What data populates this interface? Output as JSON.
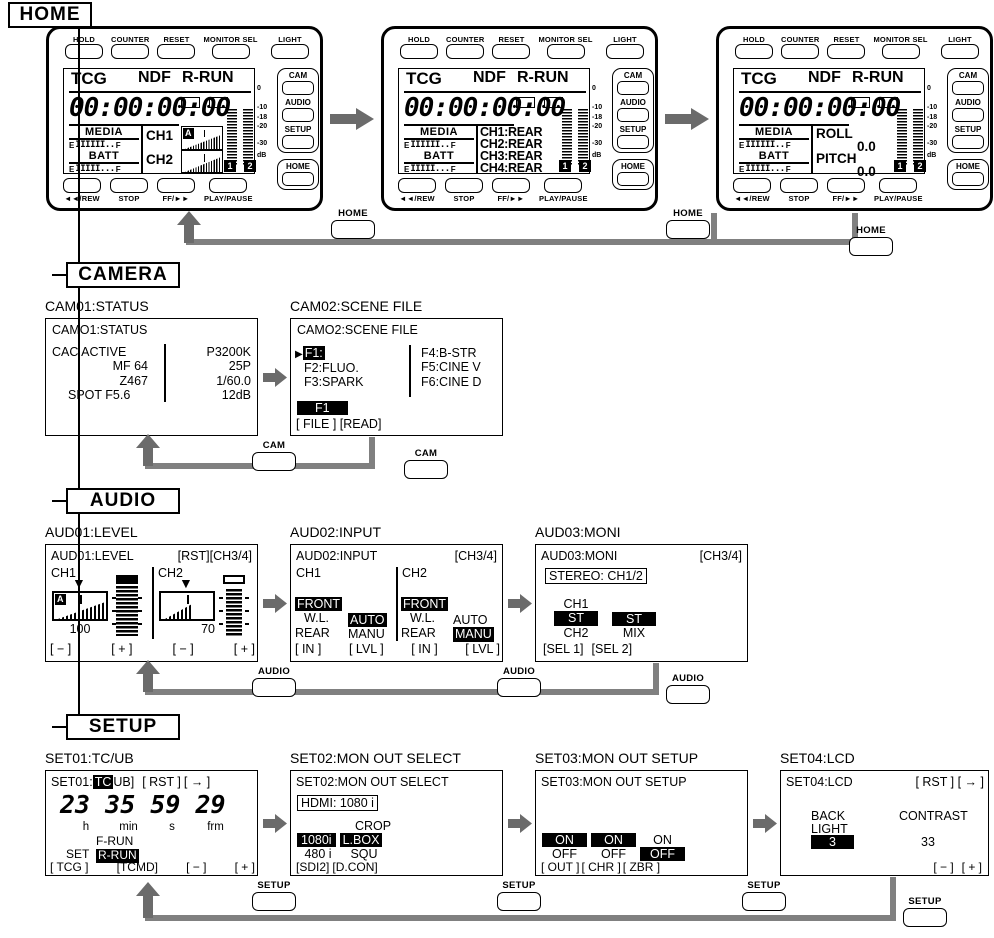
{
  "sections": {
    "home": "HOME",
    "camera": "CAMERA",
    "audio": "AUDIO",
    "setup": "SETUP"
  },
  "device_buttons": {
    "top": [
      "HOLD",
      "COUNTER",
      "RESET",
      "MONITOR SEL"
    ],
    "light": "LIGHT",
    "side": [
      "CAM",
      "AUDIO",
      "SETUP"
    ],
    "home": "HOME",
    "bottom": [
      "◄◄/REW",
      "STOP",
      "FF/►►",
      "PLAY/PAUSE"
    ]
  },
  "lcd_common": {
    "tcg": "TCG",
    "ndf": "NDF",
    "run": "R-RUN",
    "timecode": "00:00:00:00",
    "media_label": "MEDIA",
    "media_ticks": "IIIIII..",
    "batt_label": "BATT",
    "batt_ticks": "IIIII...",
    "e": "E",
    "f": "F",
    "scale": [
      "0",
      "-10",
      "-18",
      "-20",
      "-30",
      "dB"
    ],
    "badge1": "1",
    "badge2": "2"
  },
  "home_screens": [
    {
      "id": "home-1",
      "type": "ch-meter",
      "ch1": "CH1",
      "ch2": "CH2",
      "a_badge": "A"
    },
    {
      "id": "home-2",
      "type": "ch-list",
      "lines": [
        "CH1:REAR",
        "CH2:REAR",
        "CH3:REAR",
        "CH4:REAR"
      ]
    },
    {
      "id": "home-3",
      "type": "roll-pitch",
      "roll_label": "ROLL",
      "roll_value": "0.0",
      "pitch_label": "PITCH",
      "pitch_value": "0.0"
    }
  ],
  "camera": {
    "screens": [
      {
        "caption": "CAM01:STATUS",
        "header": "CAMO1:STATUS",
        "left": [
          "CAC   ACTIVE",
          "MF 64",
          "Z467",
          "SPOT   F5.6"
        ],
        "right": [
          "P3200K",
          "25P",
          "1/60.0",
          "12dB"
        ]
      },
      {
        "caption": "CAM02:SCENE FILE",
        "header": "CAMO2:SCENE FILE",
        "cursor": "▶",
        "left": [
          "F1:",
          "F2:FLUO.",
          "F3:SPARK"
        ],
        "right": [
          "F4:B-STR",
          "F5:CINE V",
          "F6:CINE D"
        ],
        "selected_file": "F1",
        "softkeys": "[ FILE ] [READ]"
      }
    ],
    "return_keys": [
      "CAM",
      "CAM"
    ]
  },
  "audio": {
    "screens": [
      {
        "caption": "AUD01:LEVEL",
        "header": "AUD01:LEVEL",
        "tags": "[RST][CH3/4]",
        "ch1": "CH1",
        "ch2": "CH2",
        "ch1_value": "100",
        "ch2_value": "70",
        "a_badge": "A",
        "softkeys": [
          "[ − ]",
          "[ + ]",
          "[ − ]",
          "[ + ]"
        ]
      },
      {
        "caption": "AUD02:INPUT",
        "header": "AUD02:INPUT",
        "tags": "[CH3/4]",
        "ch1": "CH1",
        "ch2": "CH2",
        "ch1_rows": [
          "FRONT",
          "W.L.",
          "REAR"
        ],
        "ch1_mode": [
          "AUTO",
          "MANU"
        ],
        "ch2_rows": [
          "FRONT",
          "W.L.",
          "REAR"
        ],
        "ch2_mode": [
          "AUTO",
          "MANU"
        ],
        "ch1_selected_src": "FRONT",
        "ch1_selected_mode": "AUTO",
        "ch2_selected_src": "FRONT",
        "ch2_selected_mode": "MANU",
        "softkeys": [
          "[ IN ]",
          "[ LVL ]",
          "[ IN ]",
          "[ LVL ]"
        ]
      },
      {
        "caption": "AUD03:MONI",
        "header": "AUD03:MONI",
        "tags": "[CH3/4]",
        "stereo": "STEREO: CH1/2",
        "col1": [
          "CH1",
          "ST",
          "CH2"
        ],
        "col2": [
          "",
          "ST",
          "MIX"
        ],
        "col1_selected": "ST",
        "col2_selected": "ST",
        "softkeys": [
          "[SEL 1]",
          "[SEL 2]"
        ]
      }
    ],
    "return_keys": [
      "AUDIO",
      "AUDIO",
      "AUDIO"
    ]
  },
  "setup": {
    "screens": [
      {
        "caption": "SET01:TC/UB",
        "header_prefix": "SET01:",
        "tc": "TC",
        "ub": "UB]",
        "rst": "[ RST ]",
        "arrow": "[  →  ]",
        "digits": "23 35 59 29",
        "units": [
          "h",
          "min",
          "s",
          "frm"
        ],
        "frun": "F-RUN",
        "set": "SET",
        "rrun": "R-RUN",
        "softkeys": [
          "[ TCG ]",
          "[TCMD]",
          "[ − ]",
          "[ + ]"
        ]
      },
      {
        "caption": "SET02:MON OUT SELECT",
        "header": "SET02:MON OUT SELECT",
        "hdmi": "HDMI: 1080 i",
        "crop": "CROP",
        "row1": [
          "1080i",
          "L.BOX"
        ],
        "row2": [
          "480 i",
          "SQU"
        ],
        "softkeys": [
          "[SDI2]",
          "[D.CON]"
        ]
      },
      {
        "caption": "SET03:MON OUT SETUP",
        "header": "SET03:MON OUT SETUP",
        "on_row": [
          "ON",
          "ON",
          "ON"
        ],
        "off_row": [
          "OFF",
          "OFF",
          "OFF"
        ],
        "selected": [
          "ON",
          "ON",
          "OFF"
        ],
        "softkeys": [
          "[ OUT ]",
          "[ CHR ]",
          "[ ZBR ]"
        ]
      },
      {
        "caption": "SET04:LCD",
        "header": "SET04:LCD",
        "rst": "[ RST ]",
        "arrow": "[  →  ]",
        "back": "BACK",
        "light": "LIGHT",
        "back_value": "3",
        "contrast": "CONTRAST",
        "contrast_value": "33",
        "softkeys": [
          "[ − ]",
          "[ + ]"
        ]
      }
    ],
    "return_keys": [
      "SETUP",
      "SETUP",
      "SETUP",
      "SETUP"
    ]
  },
  "home_return_keys": [
    "HOME",
    "HOME",
    "HOME"
  ],
  "colors": {
    "ink": "#000000",
    "connector": "#808080",
    "paper": "#ffffff"
  }
}
